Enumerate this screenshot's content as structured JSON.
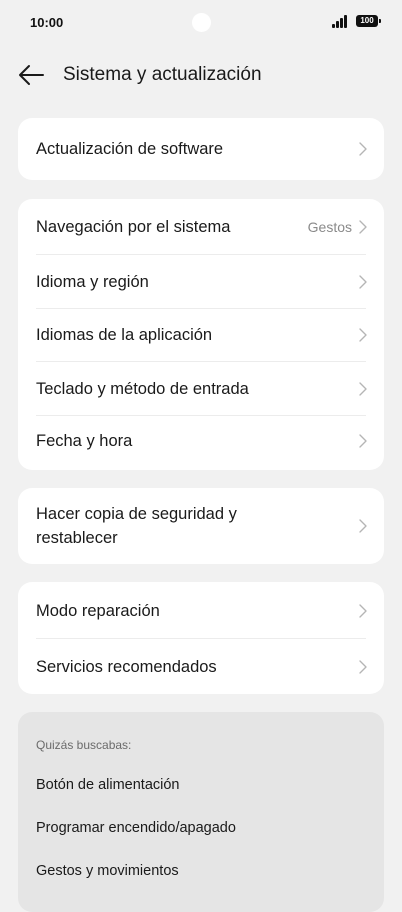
{
  "status_bar": {
    "time": "10:00",
    "battery": "100"
  },
  "header": {
    "title": "Sistema y actualización"
  },
  "groups": [
    {
      "items": [
        {
          "label": "Actualización de software",
          "value": ""
        }
      ]
    },
    {
      "items": [
        {
          "label": "Navegación por el sistema",
          "value": "Gestos"
        },
        {
          "label": "Idioma y región",
          "value": ""
        },
        {
          "label": "Idiomas de la aplicación",
          "value": ""
        },
        {
          "label": "Teclado y método de entrada",
          "value": ""
        },
        {
          "label": "Fecha y hora",
          "value": ""
        }
      ]
    },
    {
      "items": [
        {
          "label": "Hacer copia de seguridad y restablecer",
          "value": ""
        }
      ]
    },
    {
      "items": [
        {
          "label": "Modo reparación",
          "value": ""
        },
        {
          "label": "Servicios recomendados",
          "value": ""
        }
      ]
    }
  ],
  "suggestions": {
    "heading": "Quizás buscabas:",
    "items": [
      "Botón de alimentación",
      "Programar encendido/apagado",
      "Gestos y movimientos"
    ]
  }
}
